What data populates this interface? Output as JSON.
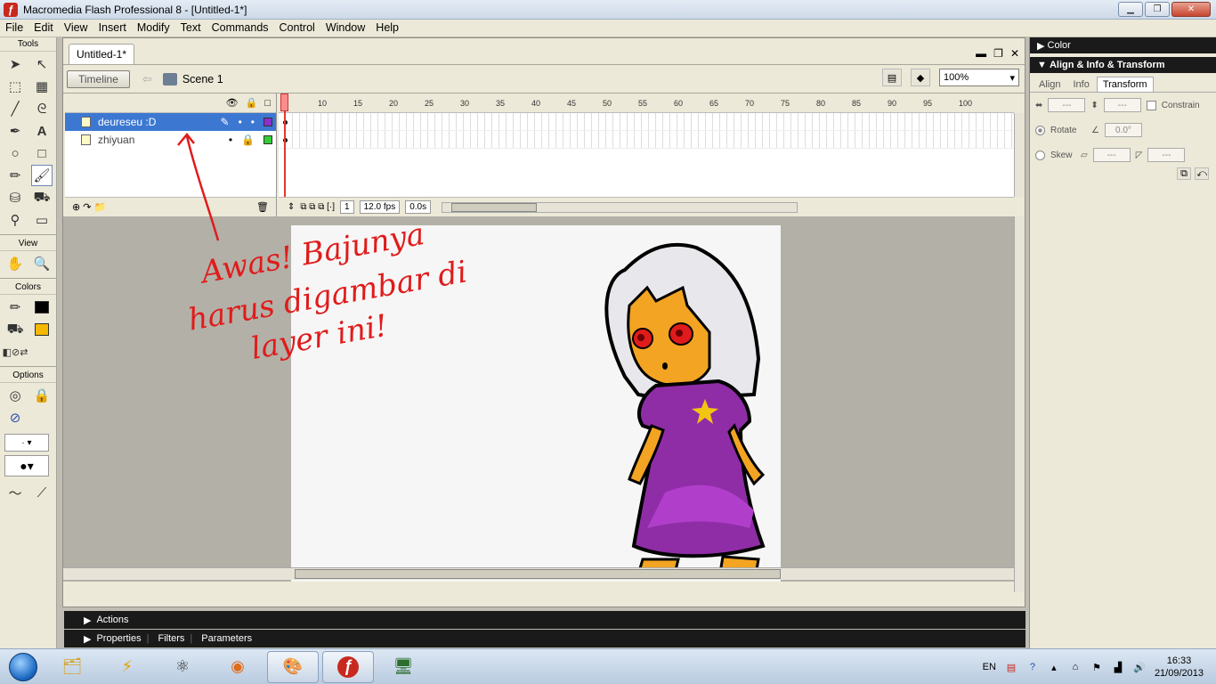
{
  "window": {
    "title": "Macromedia Flash Professional 8 - [Untitled-1*]"
  },
  "menu": [
    "File",
    "Edit",
    "View",
    "Insert",
    "Modify",
    "Text",
    "Commands",
    "Control",
    "Window",
    "Help"
  ],
  "toolbox": {
    "tools_label": "Tools",
    "view_label": "View",
    "colors_label": "Colors",
    "options_label": "Options",
    "stroke_color": "#000000",
    "fill_color": "#f5b800"
  },
  "document": {
    "tab_label": "Untitled-1*",
    "timeline_button": "Timeline",
    "scene_label": "Scene 1",
    "zoom": "100%"
  },
  "timeline": {
    "ruler": [
      "5",
      "10",
      "15",
      "20",
      "25",
      "30",
      "35",
      "40",
      "45",
      "50",
      "55",
      "60",
      "65",
      "70",
      "75",
      "80",
      "85",
      "90",
      "95",
      "100"
    ],
    "layers": [
      {
        "name": "deureseu :D",
        "color": "#8b2fc9",
        "active": true
      },
      {
        "name": "zhiyuan",
        "color": "#33cc33",
        "active": false
      }
    ],
    "current_frame": "1",
    "fps": "12.0 fps",
    "elapsed": "0.0s"
  },
  "annotation": {
    "line1": "Awas! Bajunya",
    "line2": "harus digambar di",
    "line3": "layer ini!",
    "color": "#e01b1b"
  },
  "panels": {
    "actions": "Actions",
    "properties": "Properties",
    "filters": "Filters",
    "parameters": "Parameters"
  },
  "right_panel": {
    "color_label": "Color",
    "align_info_label": "Align & Info & Transform",
    "tabs": [
      "Align",
      "Info",
      "Transform"
    ],
    "active_tab": "Transform",
    "width_value": "---",
    "height_value": "---",
    "constrain_label": "Constrain",
    "rotate_label": "Rotate",
    "rotate_value": "0.0°",
    "skew_label": "Skew",
    "skew_h": "---",
    "skew_v": "---"
  },
  "taskbar": {
    "lang": "EN",
    "time": "16:33",
    "date": "21/09/2013"
  }
}
